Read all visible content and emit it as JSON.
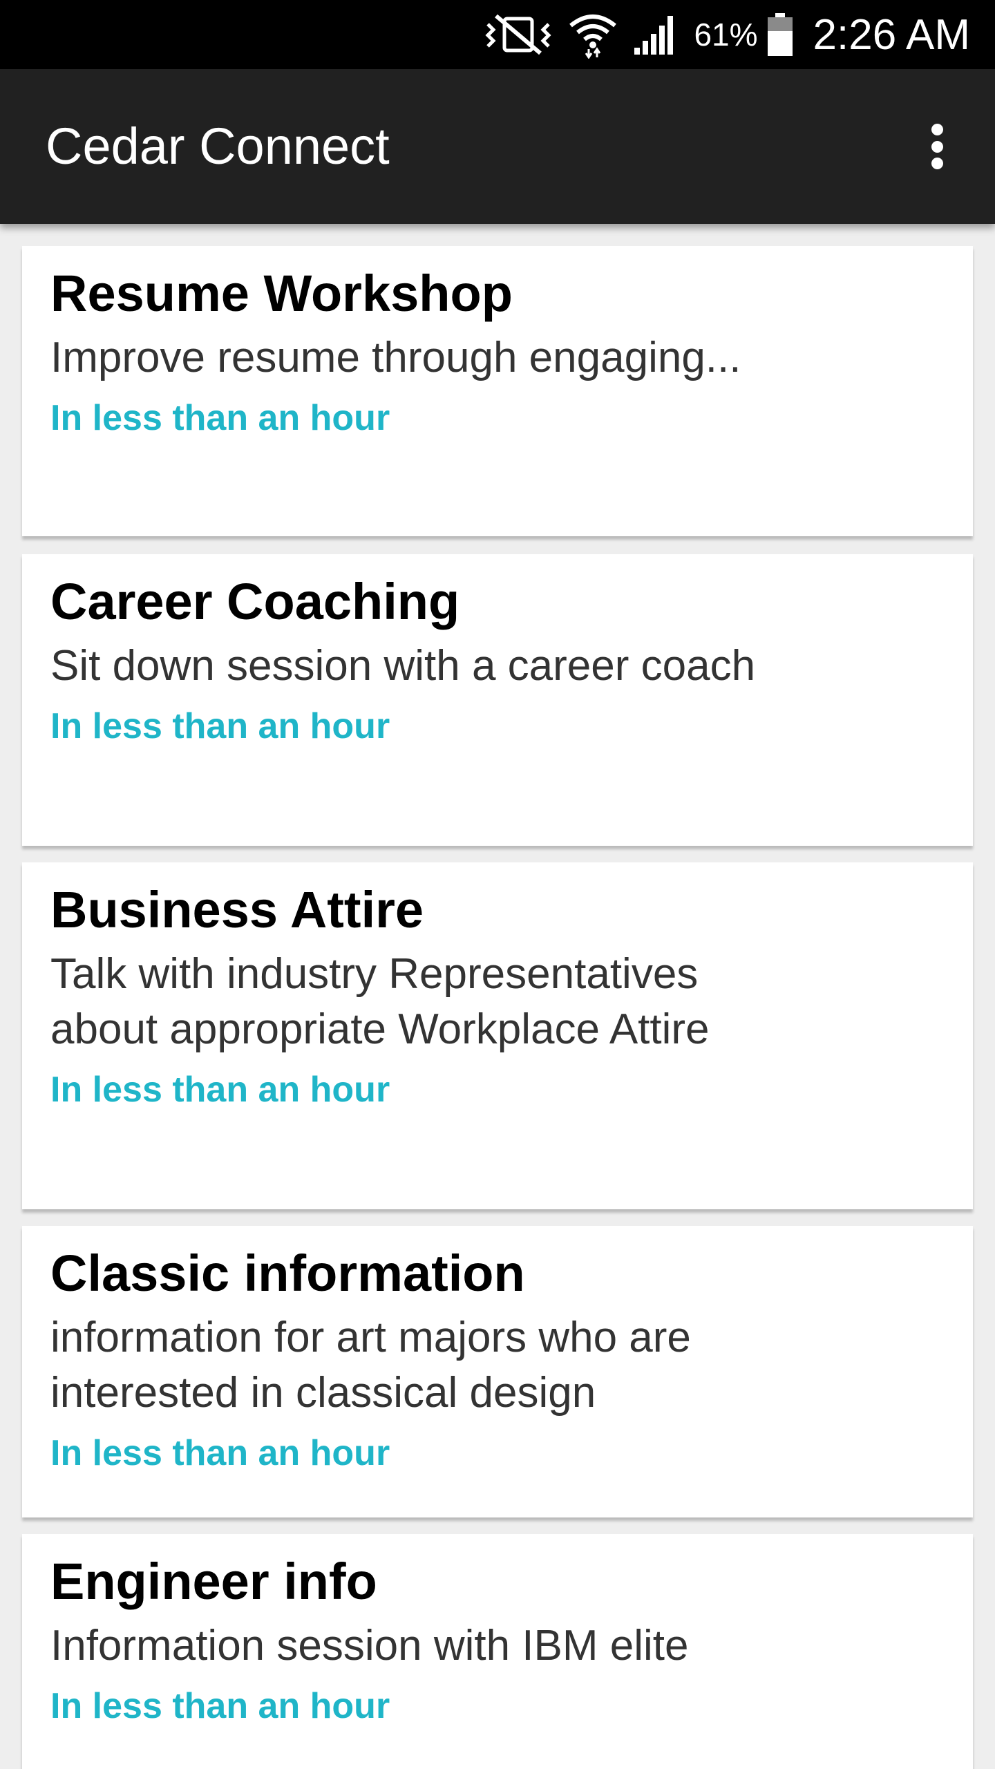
{
  "status_bar": {
    "icons": [
      "vibrate-mute-icon",
      "wifi-icon",
      "cell-signal-icon",
      "battery-icon"
    ],
    "battery_percent": "61%",
    "time": "2:26 AM"
  },
  "app_bar": {
    "title": "Cedar Connect",
    "menu_icon": "overflow-menu-icon"
  },
  "colors": {
    "app_bar": "#212121",
    "accent": "#1fb5c8",
    "background": "#eeeeee"
  },
  "events": [
    {
      "title": "Resume Workshop",
      "description": "Improve resume through engaging...",
      "time": "In less than an hour"
    },
    {
      "title": "Career Coaching",
      "description": "Sit down session with a career coach",
      "time": "In less than an hour"
    },
    {
      "title": "Business Attire",
      "description": "Talk with industry Representatives about appropriate Workplace Attire",
      "time": "In less than an hour"
    },
    {
      "title": "Classic information",
      "description": "information for art majors who are interested in classical design",
      "time": "In less than an hour"
    },
    {
      "title": "Engineer info",
      "description": "Information session with IBM elite",
      "time": "In less than an hour"
    }
  ]
}
